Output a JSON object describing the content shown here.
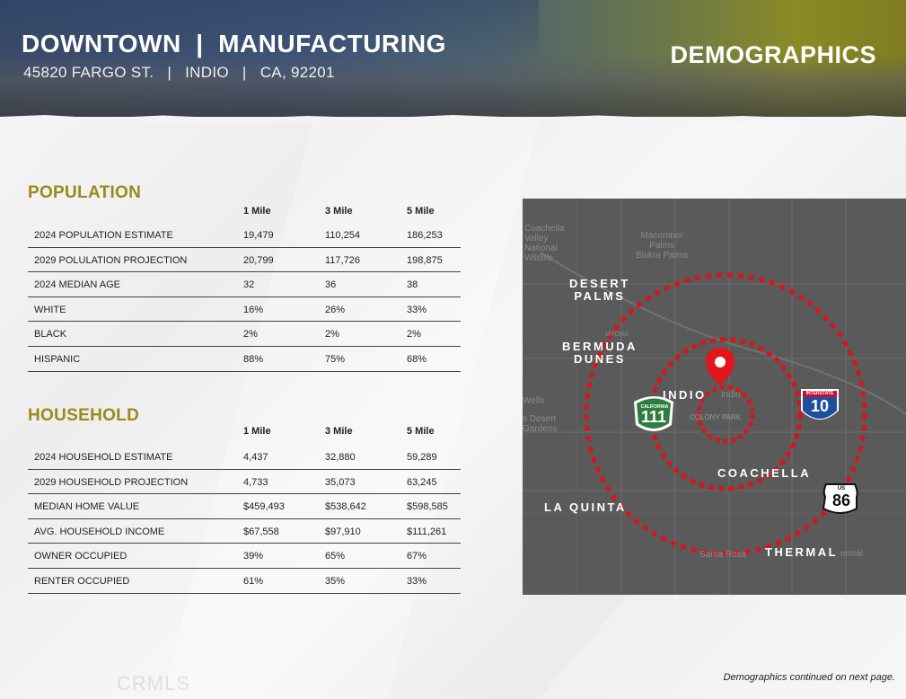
{
  "header": {
    "title": "DOWNTOWN  |  MANUFACTURING",
    "address": "45820 FARGO ST.   |   INDIO   |   CA, 92201",
    "section": "DEMOGRAPHICS"
  },
  "population": {
    "heading": "POPULATION",
    "columns": [
      "1 Mile",
      "3 Mile",
      "5 Mile"
    ],
    "rows": [
      {
        "label": "2024 POPULATION ESTIMATE",
        "v1": "19,479",
        "v3": "110,254",
        "v5": "186,253"
      },
      {
        "label": "2029 POLULATION PROJECTION",
        "v1": "20,799",
        "v3": "117,726",
        "v5": "198,875"
      },
      {
        "label": "2024 MEDIAN AGE",
        "v1": "32",
        "v3": "36",
        "v5": "38"
      },
      {
        "label": "WHITE",
        "v1": "16%",
        "v3": "26%",
        "v5": "33%"
      },
      {
        "label": "BLACK",
        "v1": "2%",
        "v3": "2%",
        "v5": "2%"
      },
      {
        "label": "HISPANIC",
        "v1": "88%",
        "v3": "75%",
        "v5": "68%"
      }
    ]
  },
  "household": {
    "heading": "HOUSEHOLD",
    "columns": [
      "1 Mile",
      "3 Mile",
      "5 Mile"
    ],
    "rows": [
      {
        "label": "2024 HOUSEHOLD ESTIMATE",
        "v1": "4,437",
        "v3": "32,880",
        "v5": "59,289"
      },
      {
        "label": "2029 HOUSEHOLD PROJECTION",
        "v1": "4,733",
        "v3": "35,073",
        "v5": "63,245"
      },
      {
        "label": "MEDIAN HOME VALUE",
        "v1": "$459,493",
        "v3": "$538,642",
        "v5": "$598,585"
      },
      {
        "label": "AVG. HOUSEHOLD INCOME",
        "v1": "$67,558",
        "v3": "$97,910",
        "v5": "$111,261"
      },
      {
        "label": "OWNER OCCUPIED",
        "v1": "39%",
        "v3": "65%",
        "v5": "67%"
      },
      {
        "label": "RENTER OCCUPIED",
        "v1": "61%",
        "v3": "35%",
        "v5": "33%"
      }
    ]
  },
  "map": {
    "labels": {
      "desert_palms": "DESERT\nPALMS",
      "bermuda_dunes": "BERMUDA\nDUNES",
      "indio": "INDIO",
      "coachella": "COACHELLA",
      "la_quinta": "LA QUINTA",
      "thermal": "THERMAL"
    },
    "shields": {
      "ca_route": "111",
      "ca_text": "CALIFORNIA",
      "interstate": "10",
      "interstate_text": "INTERSTATE",
      "us_route": "86",
      "us_text": "US"
    },
    "faint_labels": {
      "coachella_valley": "Coachella\nValley\nNational\nWildlife",
      "macomber": "Macomber\nPalms\nBiskra Palms",
      "myoma": "MYOMA",
      "wells": "Wells",
      "desert_gardens": "s Desert\nGardens",
      "colony_park": "COLONY PARK",
      "santa_rosa": "Santa Rosa",
      "indio_small": "Indio",
      "thermal_small": "ermal"
    },
    "ring_color": "#d7151b",
    "pin_color": "#e0161c"
  },
  "footer": {
    "note": "Demographics continued on next page.",
    "watermark": "CRMLS"
  },
  "colors": {
    "accent": "#9a8a1a"
  }
}
